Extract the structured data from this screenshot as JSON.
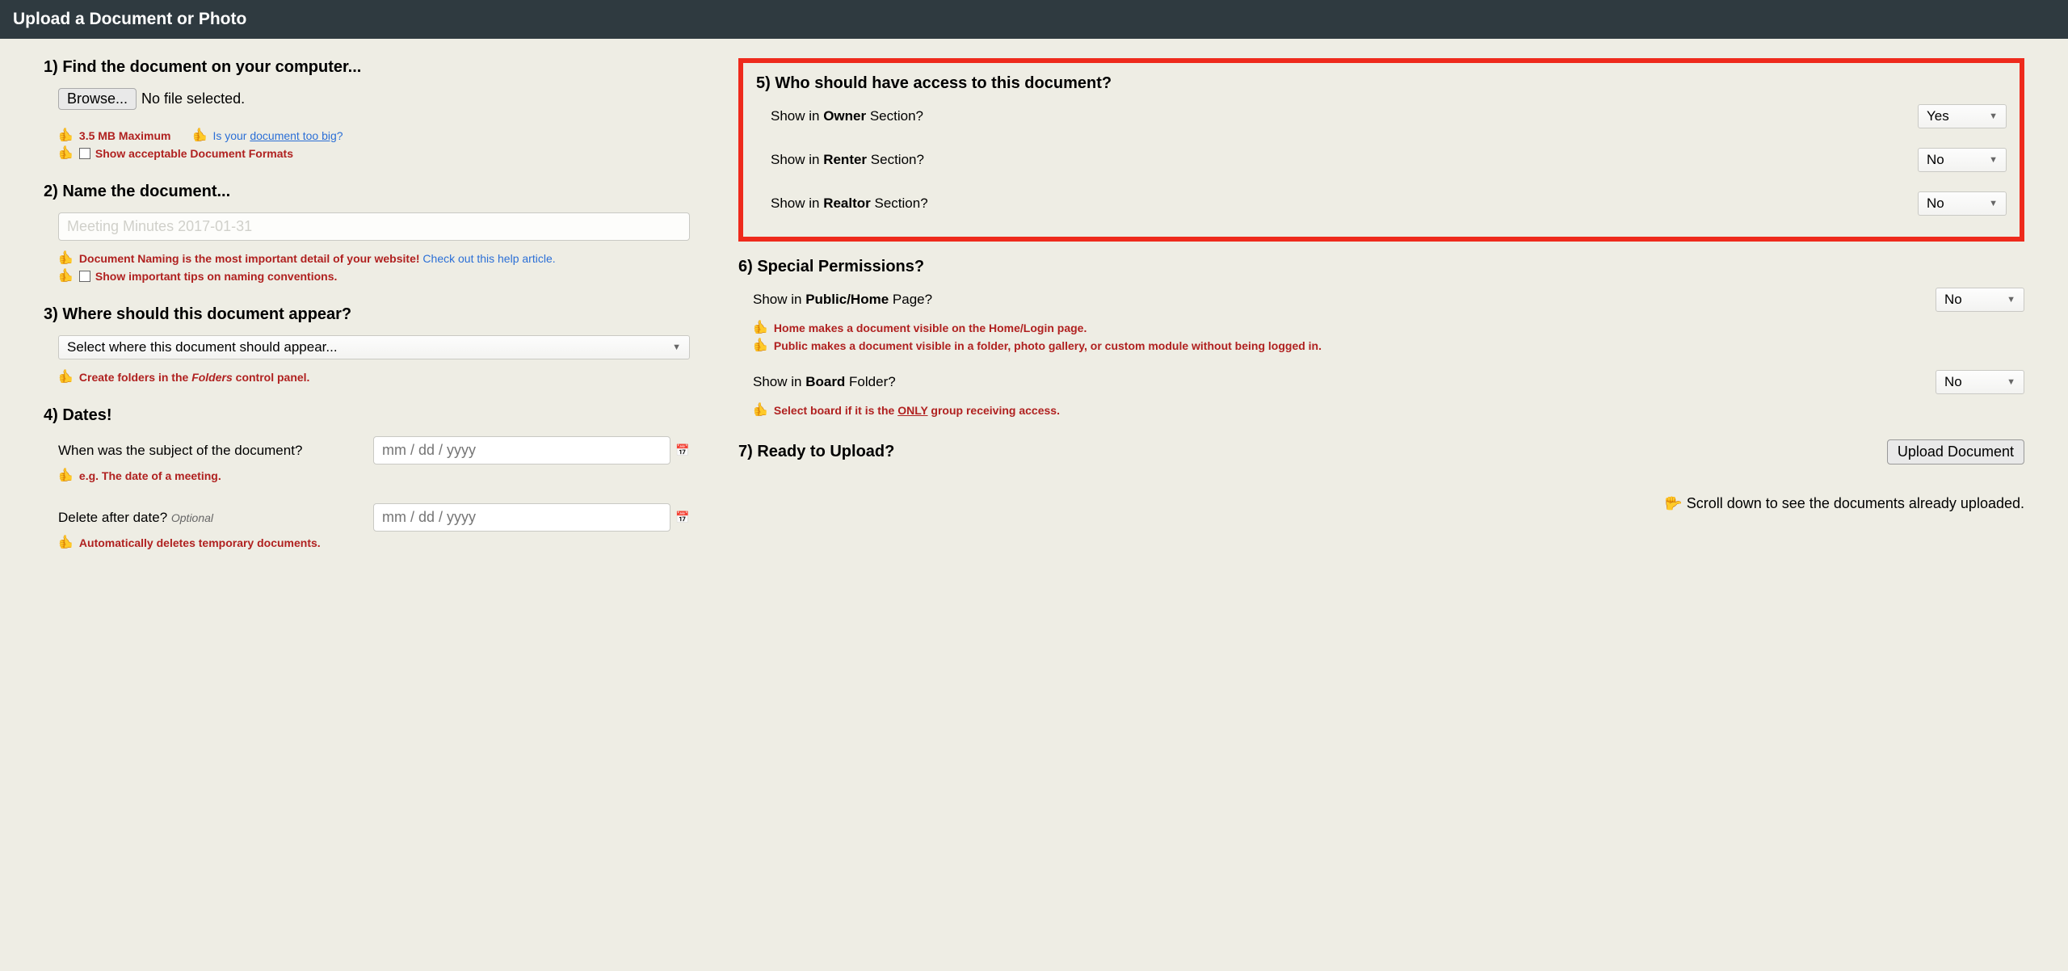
{
  "header": {
    "title": "Upload a Document or Photo"
  },
  "s1": {
    "title": "1) Find the document on your computer...",
    "browse": "Browse...",
    "nofile": "No file selected.",
    "max": "3.5 MB Maximum",
    "isyour": "Is your ",
    "toobig": "document too big",
    "q": "?",
    "formats": "Show acceptable Document Formats"
  },
  "s2": {
    "title": "2) Name the document...",
    "placeholder": "Meeting Minutes 2017-01-31",
    "naming1": "Document Naming is the most important detail of your website! ",
    "naming2": "Check out this help article.",
    "tips": "Show important tips on naming conventions."
  },
  "s3": {
    "title": "3) Where should this document appear?",
    "select": "Select where this document should appear...",
    "tip1": "Create folders in the ",
    "tip2": "Folders",
    "tip3": " control panel."
  },
  "s4": {
    "title": "4) Dates!",
    "when": "When was the subject of the document?",
    "whentip": "e.g. The date of a meeting.",
    "delete": "Delete after date? ",
    "optional": "Optional",
    "deletetip": "Automatically deletes temporary documents.",
    "dateph": "mm / dd / yyyy"
  },
  "s5": {
    "title": "5) Who should have access to this document?",
    "owner_pre": "Show in ",
    "owner_b": "Owner",
    "owner_post": " Section?",
    "owner_val": "Yes",
    "renter_pre": "Show in ",
    "renter_b": "Renter",
    "renter_post": " Section?",
    "renter_val": "No",
    "realtor_pre": "Show in ",
    "realtor_b": "Realtor",
    "realtor_post": " Section?",
    "realtor_val": "No"
  },
  "s6": {
    "title": "6) Special Permissions?",
    "public_pre": "Show in ",
    "public_b": "Public/Home",
    "public_post": " Page?",
    "public_val": "No",
    "home_b": "Home",
    "home_rest": " makes a document visible on the ",
    "home_b2": "Home/Login",
    "home_end": " page.",
    "pub_b": "Public",
    "pub_rest": " makes a document visible in a ",
    "pub_b2": "folder, photo gallery, or custom module",
    "pub_end": " without being logged in.",
    "board_pre": "Show in ",
    "board_b": "Board",
    "board_post": " Folder?",
    "board_val": "No",
    "board_tip1": "Select board if it is the ",
    "board_only": "ONLY",
    "board_tip2": " group receiving access."
  },
  "s7": {
    "title": "7) Ready to Upload?",
    "button": "Upload Document",
    "scroll": "Scroll down to see the documents already uploaded."
  }
}
